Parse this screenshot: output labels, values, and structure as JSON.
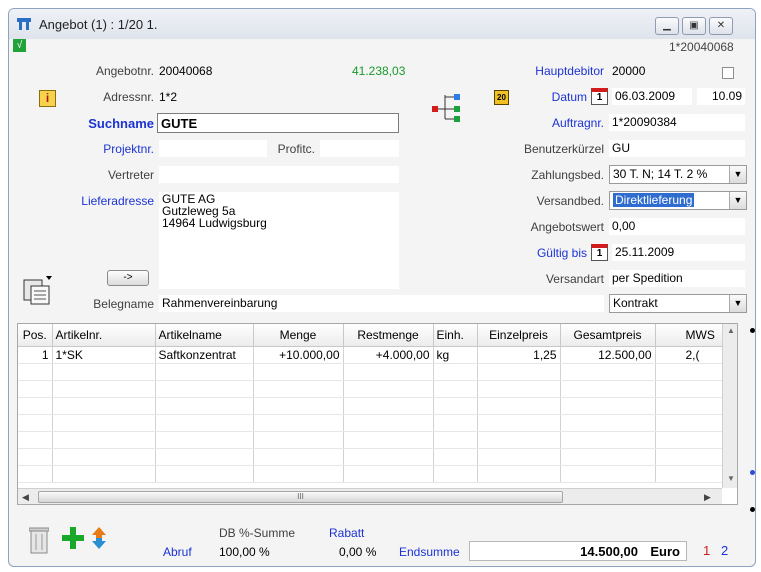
{
  "window": {
    "title": "Angebot (1) : 1/20 1.",
    "doc_ref": "1*20040068",
    "check_glyph": "√"
  },
  "header": {
    "angebotnr_label": "Angebotnr.",
    "angebotnr_value": "20040068",
    "amount": "41.238,03",
    "adressnr_label": "Adressnr.",
    "adressnr_value": "1*2",
    "suchname_label": "Suchname",
    "suchname_value": "GUTE",
    "projektnr_label": "Projektnr.",
    "projektnr_value": "",
    "profitc_label": "Profitc.",
    "profitc_value": "",
    "vertreter_label": "Vertreter",
    "vertreter_value": "",
    "lieferadresse_label": "Lieferadresse",
    "lieferadresse_line1": "GUTE AG",
    "lieferadresse_line2": "Gutzleweg 5a",
    "lieferadresse_line3": "14964 Ludwigsburg",
    "arrow_button": "->",
    "belegname_label": "Belegname",
    "belegname_value": "Rahmenvereinbarung",
    "hauptdebitor_label": "Hauptdebitor",
    "hauptdebitor_value": "20000",
    "datum_label": "Datum",
    "datum_value": "06.03.2009",
    "datum_time": "10.09",
    "auftragnr_label": "Auftragnr.",
    "auftragnr_value": "1*20090384",
    "benutzer_label": "Benutzerkürzel",
    "benutzer_value": "GU",
    "zahlung_label": "Zahlungsbed.",
    "zahlung_value": "30 T. N; 14 T. 2 %",
    "versandbed_label": "Versandbed.",
    "versandbed_value": "Direktlieferung",
    "angebotswert_label": "Angebotswert",
    "angebotswert_value": "0,00",
    "gueltig_label": "Gültig bis",
    "gueltig_value": "25.11.2009",
    "versandart_label": "Versandart",
    "versandart_value": "per Spedition",
    "kontrakt_value": "Kontrakt",
    "calendar_glyph": "1"
  },
  "table": {
    "columns": [
      "Pos.",
      "Artikelnr.",
      "Artikelname",
      "Menge",
      "Restmenge",
      "Einh.",
      "Einzelpreis",
      "Gesamtpreis",
      "MWS"
    ],
    "rows": [
      [
        "1",
        "1*SK",
        "Saftkonzentrat",
        "+10.000,00",
        "+4.000,00",
        "kg",
        "1,25",
        "12.500,00",
        "2,("
      ]
    ],
    "scroll_thumb": "III"
  },
  "footer": {
    "db_summe_label": "DB %-Summe",
    "rabatt_label": "Rabatt",
    "abruf_label": "Abruf",
    "db_value": "100,00 %",
    "rabatt_value": "0,00 %",
    "endsumme_label": "Endsumme",
    "endsumme_value": "14.500,00",
    "currency": "Euro",
    "page1": "1",
    "page2": "2"
  }
}
